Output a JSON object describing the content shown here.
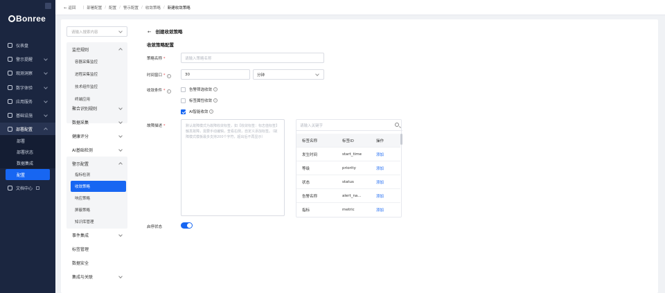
{
  "app": {
    "logo_text": "Bonree"
  },
  "sidebar": {
    "items": [
      {
        "label": "仪表盘",
        "icon": "dashboard-icon"
      },
      {
        "label": "警示提醒",
        "icon": "bell-icon"
      },
      {
        "label": "观测洞察",
        "icon": "insight-icon"
      },
      {
        "label": "数字体验",
        "icon": "monitor-icon"
      },
      {
        "label": "应用服务",
        "icon": "app-icon"
      },
      {
        "label": "基础设施",
        "icon": "server-icon"
      },
      {
        "label": "部署配置",
        "icon": "wrench-icon"
      }
    ],
    "sub_items": [
      {
        "label": "部署"
      },
      {
        "label": "部署状态"
      },
      {
        "label": "数据集成"
      },
      {
        "label": "配置"
      }
    ],
    "doc_center": "文档中心"
  },
  "topbar": {
    "back": "← 返回",
    "crumbs": [
      "部署配置",
      "配置",
      "警示配置",
      "收敛策略",
      "新建收敛策略"
    ]
  },
  "left_menu": {
    "search_placeholder": "请输入搜索内容",
    "group1_title": "监控规则",
    "group1_items": [
      "容器采集监控",
      "进程采集监控",
      "技术组件监控",
      "终端应用"
    ],
    "items_mid": [
      "聚合识别规则",
      "数据采集",
      "健康评分",
      "AI基础检测"
    ],
    "group2_title": "警示配置",
    "group2_items": [
      "指标检测",
      "收敛策略",
      "响应策略",
      "屏蔽策略",
      "知识库管理"
    ],
    "items_bottom": [
      "事件集成",
      "标签管理",
      "数据安全",
      "集成与关联"
    ]
  },
  "form": {
    "title": "创建收敛策略",
    "section": "收敛策略配置",
    "name_label": "策略名称",
    "name_placeholder": "请输入策略名称",
    "window_label": "时间窗口",
    "window_value": "30",
    "window_unit": "分钟",
    "cond_label": "收敛条件",
    "cond_options": [
      {
        "label": "告警筛选收敛",
        "checked": false
      },
      {
        "label": "标签属性收敛",
        "checked": false
      },
      {
        "label": "AI智能收敛",
        "checked": true
      }
    ],
    "desc_label": "故障描述",
    "desc_placeholder": "默认故障模式为故障收敛标签，如【收敛标签：标志值标签】触发故障，需要手动编辑，查看右侧，自定义添加标签。（故障模式模板最多支持200个字符，超出后不再显示）",
    "tag_search_placeholder": "请输入关键字",
    "tag_table": {
      "headers": [
        "标签名称",
        "标签ID",
        "操作"
      ],
      "rows": [
        [
          "发生时间",
          "start_time",
          "添加"
        ],
        [
          "等级",
          "priority",
          "添加"
        ],
        [
          "状态",
          "status",
          "添加"
        ],
        [
          "告警名称",
          "alert_na...",
          "添加"
        ],
        [
          "指标",
          "metric",
          "添加"
        ]
      ]
    },
    "enable_label": "启停状态",
    "enable_value": true
  },
  "colors": {
    "accent": "#1766f2",
    "sidebar_bg": "#1b2640",
    "required": "#e5484d"
  }
}
